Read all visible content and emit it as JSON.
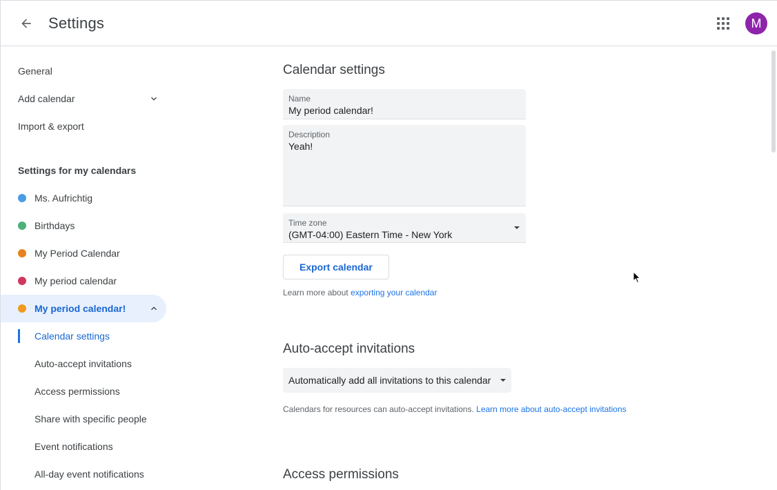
{
  "header": {
    "title": "Settings",
    "avatar_initial": "M"
  },
  "sidebar": {
    "top_items": [
      {
        "label": "General"
      },
      {
        "label": "Add calendar"
      },
      {
        "label": "Import & export"
      }
    ],
    "section_heading": "Settings for my calendars",
    "calendars": [
      {
        "label": "Ms. Aufrichtig",
        "color": "#4285f4"
      },
      {
        "label": "Birthdays",
        "color": "#33b679"
      },
      {
        "label": "My Period Calendar",
        "color": "#ef6c00"
      },
      {
        "label": "My period calendar",
        "color": "#d81b60"
      },
      {
        "label": "My period calendar!",
        "color": "#f09300"
      }
    ],
    "sub_items": [
      {
        "label": "Calendar settings"
      },
      {
        "label": "Auto-accept invitations"
      },
      {
        "label": "Access permissions"
      },
      {
        "label": "Share with specific people"
      },
      {
        "label": "Event notifications"
      },
      {
        "label": "All-day event notifications"
      }
    ]
  },
  "main": {
    "calendar_settings": {
      "heading": "Calendar settings",
      "name_label": "Name",
      "name_value": "My period calendar!",
      "description_label": "Description",
      "description_value": "Yeah!",
      "timezone_label": "Time zone",
      "timezone_value": "(GMT-04:00) Eastern Time - New York",
      "export_button": "Export calendar",
      "learn_more_prefix": "Learn more about ",
      "learn_more_link": "exporting your calendar"
    },
    "auto_accept": {
      "heading": "Auto-accept invitations",
      "dropdown_value": "Automatically add all invitations to this calendar",
      "helper_text": "Calendars for resources can auto-accept invitations. ",
      "helper_link": "Learn more about auto-accept invitations"
    },
    "access_permissions": {
      "heading": "Access permissions"
    }
  },
  "colors": {
    "accent": "#1a73e8",
    "active_bg": "#e8f0fe",
    "avatar": "#8e24aa"
  }
}
